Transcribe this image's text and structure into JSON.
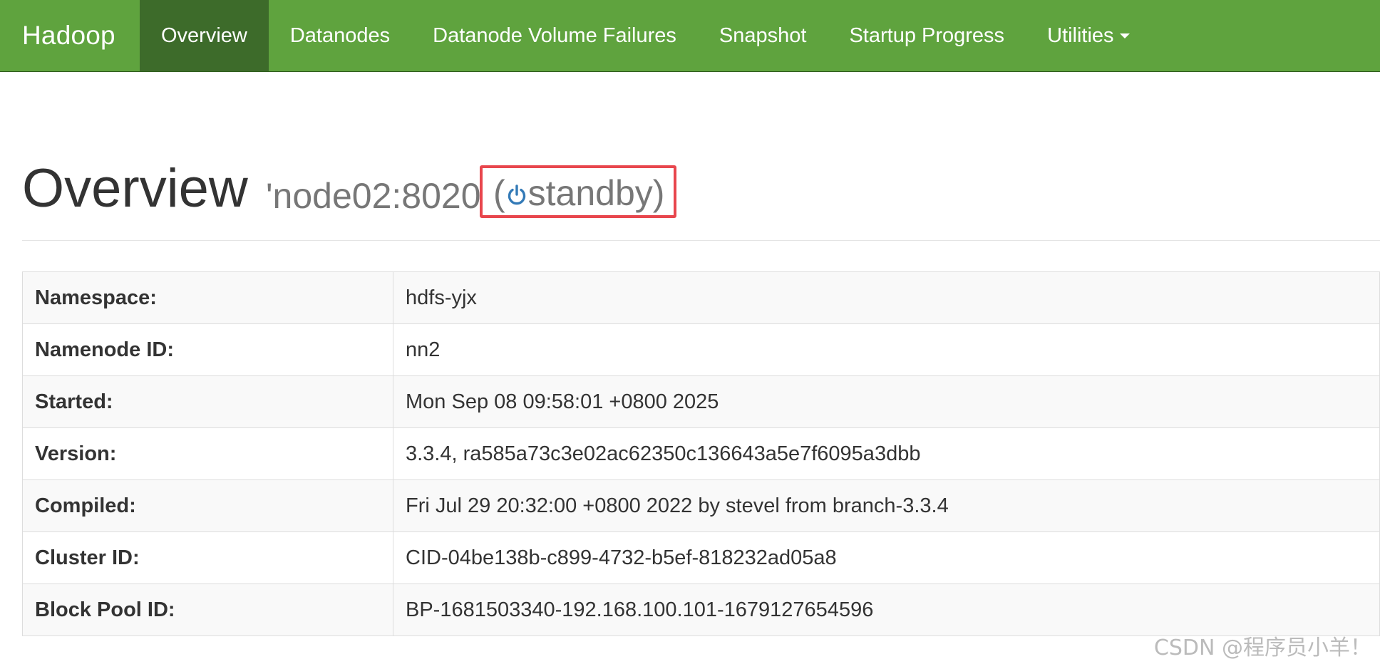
{
  "navbar": {
    "brand": "Hadoop",
    "items": [
      {
        "label": "Overview",
        "active": true
      },
      {
        "label": "Datanodes"
      },
      {
        "label": "Datanode Volume Failures"
      },
      {
        "label": "Snapshot"
      },
      {
        "label": "Startup Progress"
      },
      {
        "label": "Utilities",
        "dropdown": true
      }
    ],
    "colors": {
      "background": "#5fa33e",
      "active": "#3d6b2a"
    }
  },
  "header": {
    "title": "Overview",
    "host": "'node02:8020",
    "state_open": "(",
    "state": "standby",
    "state_close": ")",
    "state_icon": "power-icon",
    "highlight_color": "#e8464d"
  },
  "info": {
    "rows": [
      {
        "key": "Namespace:",
        "value": "hdfs-yjx"
      },
      {
        "key": "Namenode ID:",
        "value": "nn2"
      },
      {
        "key": "Started:",
        "value": "Mon Sep 08 09:58:01 +0800 2025"
      },
      {
        "key": "Version:",
        "value": "3.3.4, ra585a73c3e02ac62350c136643a5e7f6095a3dbb"
      },
      {
        "key": "Compiled:",
        "value": "Fri Jul 29 20:32:00 +0800 2022 by stevel from branch-3.3.4"
      },
      {
        "key": "Cluster ID:",
        "value": "CID-04be138b-c899-4732-b5ef-818232ad05a8"
      },
      {
        "key": "Block Pool ID:",
        "value": "BP-1681503340-192.168.100.101-1679127654596"
      }
    ]
  },
  "watermark": "CSDN @程序员小羊！"
}
